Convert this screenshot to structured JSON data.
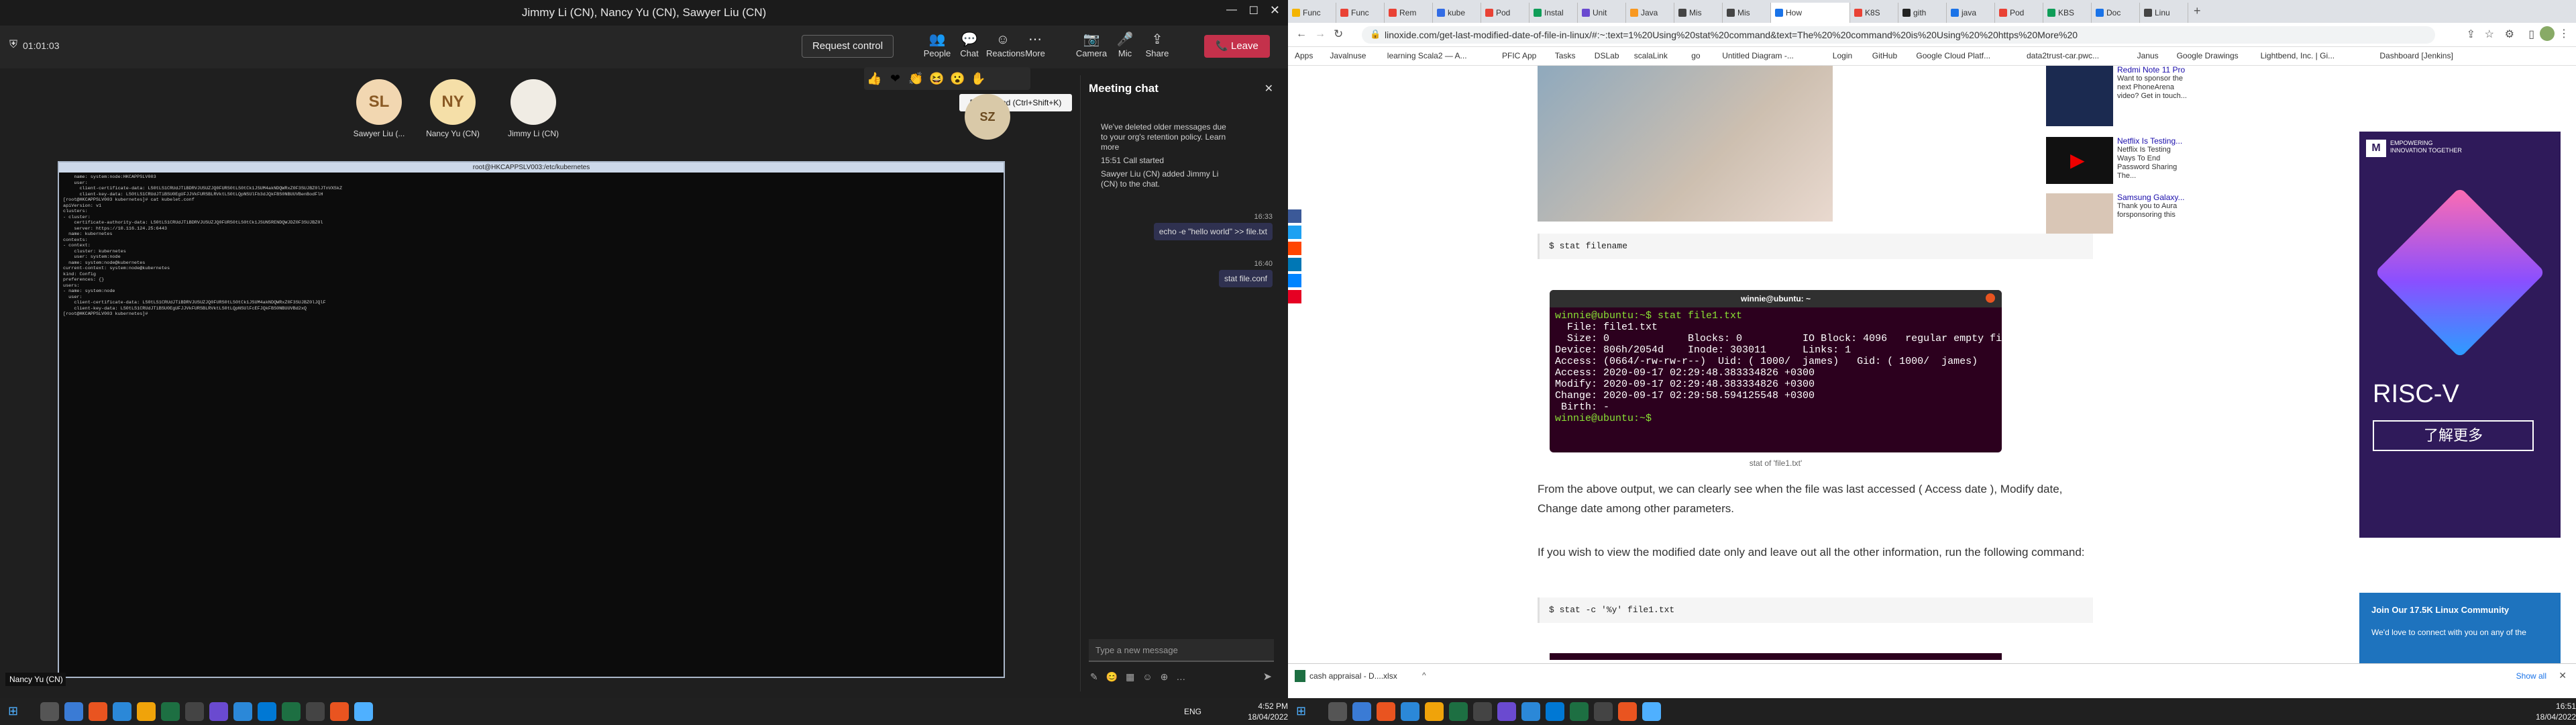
{
  "teams": {
    "window_title": "Jimmy Li (CN), Nancy Yu (CN), Sawyer Liu (CN)",
    "timer": "01:01:03",
    "request_control": "Request control",
    "toolbar": [
      {
        "label": "People",
        "icon": "people-icon",
        "glyph": "👥"
      },
      {
        "label": "Chat",
        "icon": "chat-icon",
        "glyph": "💬"
      },
      {
        "label": "Reactions",
        "icon": "reactions-icon",
        "glyph": "☺"
      },
      {
        "label": "More",
        "icon": "more-icon",
        "glyph": "⋯"
      },
      {
        "label": "Camera",
        "icon": "camera-icon",
        "glyph": "📷"
      },
      {
        "label": "Mic",
        "icon": "mic-icon",
        "glyph": "🎤"
      },
      {
        "label": "Share",
        "icon": "share-icon",
        "glyph": "⇪"
      }
    ],
    "leave": "Leave",
    "participants": [
      {
        "initials": "SL",
        "name": "Sawyer Liu (...",
        "color": "#f2d7b1"
      },
      {
        "initials": "NY",
        "name": "Nancy Yu (CN)",
        "color": "#f5dfa8"
      },
      {
        "initials": "",
        "name": "Jimmy Li (CN)",
        "color": "#f0ece4"
      }
    ],
    "reactions": [
      "👍",
      "❤",
      "👏",
      "😆",
      "😮",
      "✋"
    ],
    "raise_hand_tooltip": "Raise hand (Ctrl+Shift+K)",
    "sz_avatar": "SZ"
  },
  "terminal": {
    "title": "root@HKCAPPSLV003:/etc/kubernetes",
    "lines": [
      "    name: system:node:HKCAPPSLV003",
      "    user:",
      "      client-certificate-data: LS0tLS1CRUdJTiBDRVJUSUZJQ0FURS0tLS0tCk1JSUM4akNDQWRxZ0F3SUJBZ0lJTnVXSkZ",
      "      client-key-data: LS0tLS1CRUdJTiBSU0EgUFJJVkFURSBLRVktLS0tLQpNSUlFb3dJQkFBS0NBUUVBenBodFlH",
      "[root@HKCAPPSLV003 kubernetes]# cat kubelet.conf",
      "apiVersion: v1",
      "clusters:",
      "- cluster:",
      "    certificate-authority-data: LS0tLS1CRUdJTiBDRVJUSUZJQ0FURS0tLS0tCk1JSUN5RENDQWJDZ0F3SUJBZ0l",
      "    server: https://10.116.124.25:6443",
      "  name: kubernetes",
      "contexts:",
      "- context:",
      "    cluster: kubernetes",
      "    user: system:node",
      "  name: system:node@kubernetes",
      "current-context: system:node@kubernetes",
      "kind: Config",
      "preferences: {}",
      "users:",
      "- name: system:node",
      "  user:",
      "    client-certificate-data: LS0tLS1CRUdJTiBDRVJUSUZJQ0FURS0tLS0tCk1JSUM4akNDQWRxZ0F3SUJBZ0lJQlF",
      "    client-key-data: LS0tLS1CRUdJTiBSU0EgUFJJVkFURSBLRVktLS0tLQpNSUlFcEFJQkFBS0NBUUVBd2xQ",
      "[root@HKCAPPSLV003 kubernetes]# "
    ]
  },
  "chat": {
    "title": "Meeting chat",
    "system_msgs": [
      "We've deleted older messages due to your org's retention policy. Learn more",
      "15:51  Call started",
      "Sawyer Liu (CN) added Jimmy Li (CN) to the chat."
    ],
    "messages": [
      {
        "time": "16:33",
        "text": "echo -e \"hello world\" >> file.txt"
      },
      {
        "time": "16:40",
        "text": "stat file.conf"
      }
    ],
    "input_placeholder": "Type a new message"
  },
  "video_label": "Nancy Yu (CN)",
  "taskbar_left": {
    "lang": "ENG",
    "time": "4:52 PM",
    "date": "18/04/2022"
  },
  "browser": {
    "tabs": [
      "Func",
      "Func",
      "Rem",
      "kube",
      "Pod",
      "Instal",
      "Unit",
      "Java",
      "Mis",
      "Mis",
      "How",
      "K8S",
      "gith",
      "java",
      "Pod",
      "KBS",
      "Doc",
      "Linu"
    ],
    "active_tab": 10,
    "url": "linoxide.com/get-last-modified-date-of-file-in-linux/#:~:text=1%20Using%20stat%20command&text=The%20%20command%20is%20Using%20%20https%20More%20",
    "bookmarks": [
      "Apps",
      "Javalnuse",
      "learning Scala2 — A...",
      "PFIC App",
      "Tasks",
      "DSLab",
      "scalaLink",
      "go",
      "Untitled Diagram -...",
      "Login",
      "GitHub",
      "Google Cloud Platf...",
      "data2trust-car.pwc...",
      "Janus",
      "Google Drawings",
      "Lightbend, Inc. | Gi...",
      "Dashboard [Jenkins]"
    ],
    "code1": "$ stat filename",
    "ubuntu_title": "winnie@ubuntu: ~",
    "ubuntu_lines": [
      "winnie@ubuntu:~$ stat file1.txt",
      "  File: file1.txt",
      "  Size: 0             Blocks: 0          IO Block: 4096   regular empty file",
      "Device: 806h/2054d    Inode: 303011      Links: 1",
      "Access: (0664/-rw-rw-r--)  Uid: ( 1000/  james)   Gid: ( 1000/  james)",
      "Access: 2020-09-17 02:29:48.383334826 +0300",
      "Modify: 2020-09-17 02:29:48.383334826 +0300",
      "Change: 2020-09-17 02:29:58.594125548 +0300",
      " Birth: -",
      "winnie@ubuntu:~$"
    ],
    "caption": "stat of 'file1.txt'",
    "para1": "From the above output, we can clearly see when the file was last accessed ( Access date ),  Modify date,  Change date among other parameters.",
    "para2": "If you wish to view the modified date only and leave out all the other information, run the following command:",
    "code2": "$ stat -c '%y' file1.txt",
    "sidebar_news": [
      {
        "title": "Redmi Note 11 Pro",
        "text": "Want to sponsor the next PhoneArena video? Get in touch..."
      },
      {
        "title": "Netflix Is Testing...",
        "text": "Netflix Is Testing Ways To End Password Sharing The..."
      },
      {
        "title": "Samsung Galaxy...",
        "text": "Thank you to Aura forsponsoring this"
      }
    ],
    "ad": {
      "brand": "EMPOWERING INNOVATION TOGETHER",
      "title": "RISC-V",
      "button": "了解更多"
    },
    "community": {
      "title": "Join Our 17.5K Linux Community",
      "text": "We'd love to connect with you on any of the"
    },
    "download": "cash appraisal - D....xlsx",
    "show_all": "Show all",
    "taskbar_time": "16:51",
    "taskbar_date": "18/04/2022"
  },
  "colors": {
    "teams_leave": "#c4314b",
    "ubuntu_bg": "#2c001e",
    "ad_bg": "#2f1a5a",
    "link": "#1a0dab"
  }
}
